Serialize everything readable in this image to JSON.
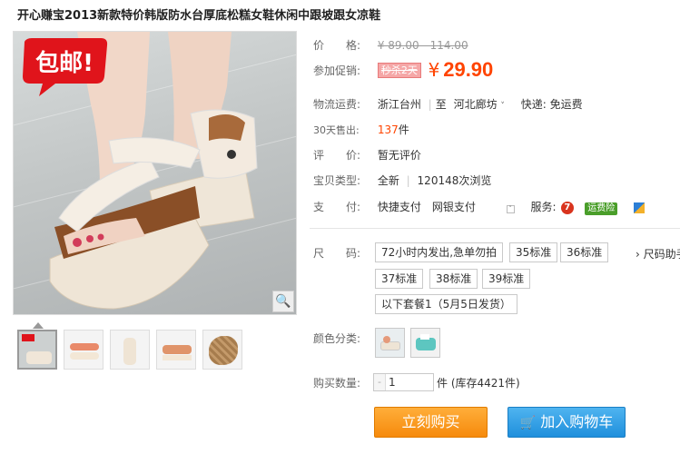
{
  "title": "开心赚宝2013新款特价韩版防水台厚底松糕女鞋休闲中跟坡跟女凉鞋",
  "badge_text": "包邮!",
  "price": {
    "label": "价　　格:",
    "value": "¥ 89.00 - 114.00"
  },
  "promo": {
    "label": "参加促销:",
    "tag": "秒杀2天",
    "yen": "¥",
    "value": "29.90"
  },
  "shipping": {
    "label": "物流运费:",
    "from": "浙江台州",
    "to_prefix": "至",
    "to": "河北廊坊",
    "method": "快递: 免运费"
  },
  "sales": {
    "label": "30天售出:",
    "count": "137",
    "unit": "件"
  },
  "rating": {
    "label": "评　　价:",
    "value": "暂无评价"
  },
  "item_type": {
    "label": "宝贝类型:",
    "value": "全新",
    "views": "120148次浏览"
  },
  "payment": {
    "label": "支　　付:",
    "value": "快捷支付　网银支付",
    "service_label": "服务:",
    "service_badge": "运费险"
  },
  "size": {
    "label": "尺　　码:",
    "guide": "尺码助手",
    "options": [
      "72小时内发出,急单勿拍",
      "35标准",
      "36标准",
      "37标准",
      "38标准",
      "39标准",
      "以下套餐1（5月5日发货）"
    ]
  },
  "color": {
    "label": "颜色分类:"
  },
  "quantity": {
    "label": "购买数量:",
    "value": "1",
    "stock": "件 (库存4421件)"
  },
  "buttons": {
    "buy_now": "立刻购买",
    "add_cart": "加入购物车"
  },
  "colors": {
    "accent": "#ff4400",
    "buy": "#f68a0c",
    "cart": "#1f8fdc"
  }
}
